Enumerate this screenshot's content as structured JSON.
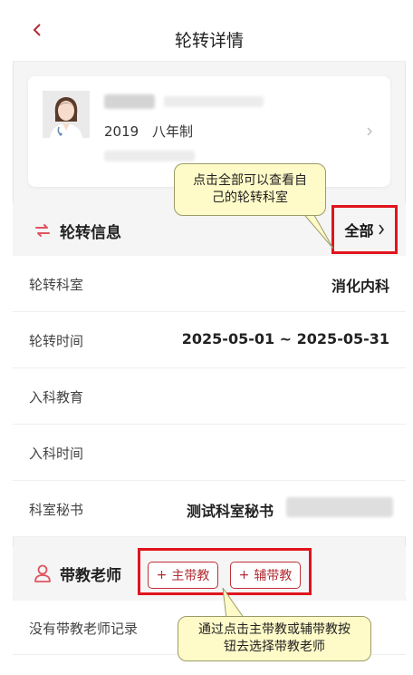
{
  "header": {
    "title": "轮转详情"
  },
  "profile": {
    "grade_year": "2019",
    "program": "八年制"
  },
  "rotation_info": {
    "section_title": "轮转信息",
    "all_label": "全部",
    "rows": [
      {
        "label": "轮转科室",
        "value": "消化内科"
      },
      {
        "label": "轮转时间",
        "value": "2025-05-01 ~ 2025-05-31"
      },
      {
        "label": "入科教育",
        "value": ""
      },
      {
        "label": "入科时间",
        "value": ""
      },
      {
        "label": "科室秘书",
        "value": "测试科室秘书"
      }
    ]
  },
  "teacher": {
    "section_title": "带教老师",
    "main_btn": "主带教",
    "assist_btn": "辅带教",
    "empty_text": "没有带教老师记录"
  },
  "callouts": {
    "all_hint": "点击全部可以查看自己的轮转科室",
    "teacher_hint": "通过点击主带教或辅带教按钮去选择带教老师"
  },
  "colors": {
    "accent": "#e0141e",
    "brand_red": "#b22a33",
    "callout_bg": "#fffbc8"
  },
  "icons": [
    "back-arrow-icon",
    "chevron-right-icon",
    "rotation-swap-icon",
    "person-icon",
    "plus-icon"
  ]
}
